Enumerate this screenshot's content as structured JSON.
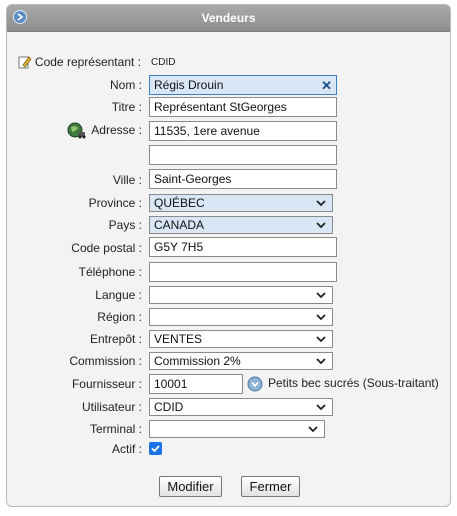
{
  "window": {
    "title": "Vendeurs"
  },
  "form": {
    "code_label": "Code représentant :",
    "code_value": "CDID",
    "nom_label": "Nom :",
    "nom_value": "Régis Drouin",
    "titre_label": "Titre :",
    "titre_value": "Représentant StGeorges",
    "adresse_label": "Adresse :",
    "adresse_line1": "11535, 1ere avenue",
    "adresse_line2": "",
    "ville_label": "Ville :",
    "ville_value": "Saint-Georges",
    "province_label": "Province :",
    "province_value": "QUÉBEC",
    "pays_label": "Pays :",
    "pays_value": "CANADA",
    "code_postal_label": "Code postal :",
    "code_postal_value": "G5Y 7H5",
    "telephone_label": "Téléphone :",
    "telephone_value": "",
    "langue_label": "Langue :",
    "langue_value": "",
    "region_label": "Région :",
    "region_value": "",
    "entrepot_label": "Entrepôt :",
    "entrepot_value": "VENTES",
    "commission_label": "Commission :",
    "commission_value": "Commission 2%",
    "fournisseur_label": "Fournisseur :",
    "fournisseur_value": "10001",
    "fournisseur_name": "Petits bec sucrés (Sous-traitant)",
    "utilisateur_label": "Utilisateur :",
    "utilisateur_value": "CDID",
    "terminal_label": "Terminal :",
    "terminal_value": "",
    "actif_label": "Actif :",
    "actif_checked": true
  },
  "buttons": {
    "modifier": "Modifier",
    "fermer": "Fermer"
  },
  "colors": {
    "accent": "#3c7fc4",
    "titlebar": "#9a9a9a",
    "checkbox": "#1a73e8"
  },
  "icons": [
    "collapse-icon",
    "edit-pencil-icon",
    "map-locator-icon",
    "clear-icon",
    "chevron-down-icon",
    "lookup-icon",
    "check-icon"
  ]
}
